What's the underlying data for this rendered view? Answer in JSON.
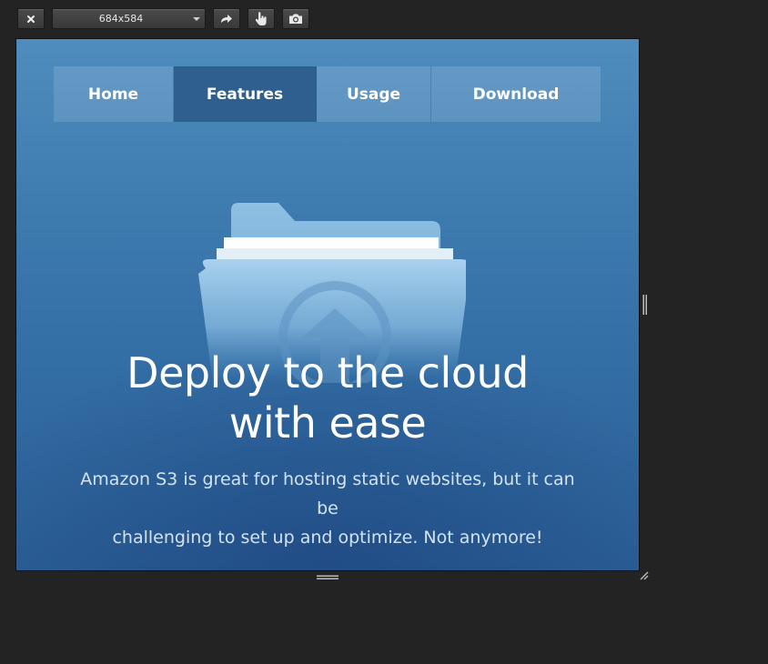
{
  "toolbar": {
    "close_icon": "close-icon",
    "size_value": "684x584",
    "rotate_icon": "rotate-icon",
    "touch_icon": "touch-pointer-icon",
    "screenshot_icon": "camera-icon"
  },
  "site": {
    "nav": [
      {
        "label": "Home",
        "active": false
      },
      {
        "label": "Features",
        "active": true
      },
      {
        "label": "Usage",
        "active": false
      },
      {
        "label": "Download",
        "active": false
      }
    ],
    "hero_icon": "folder-upload-icon",
    "headline_line1": "Deploy to the cloud",
    "headline_line2": "with ease",
    "subtext_line1": "Amazon S3 is great for hosting static websites, but it can be",
    "subtext_line2": "challenging to set up and optimize. Not anymore!"
  },
  "colors": {
    "nav_active": "#2e5f8f",
    "background_top": "#4f8dbe",
    "background_bottom": "#2b5f96"
  }
}
